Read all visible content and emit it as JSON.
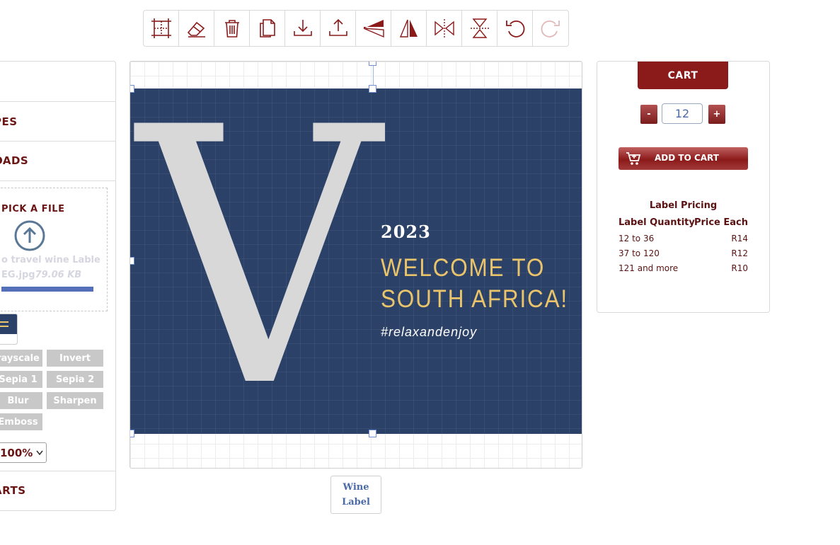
{
  "toolbar": {
    "tools": [
      {
        "icon": "crop-icon",
        "enabled": true
      },
      {
        "icon": "eraser-icon",
        "enabled": true
      },
      {
        "icon": "trash-icon",
        "enabled": true
      },
      {
        "icon": "copy-icon",
        "enabled": true
      },
      {
        "icon": "download-icon",
        "enabled": true
      },
      {
        "icon": "upload-icon",
        "enabled": true
      },
      {
        "icon": "send-back-icon",
        "enabled": true
      },
      {
        "icon": "bring-front-icon",
        "enabled": true
      },
      {
        "icon": "flip-horizontal-icon",
        "enabled": true
      },
      {
        "icon": "flip-vertical-icon",
        "enabled": true
      },
      {
        "icon": "undo-icon",
        "enabled": true
      },
      {
        "icon": "redo-icon",
        "enabled": false
      }
    ]
  },
  "left_panel": {
    "section_shapes": "PES",
    "section_uploads": "OADS",
    "upload": {
      "pick_label": "PICK A FILE",
      "file_name": "o travel wine Lable",
      "file_ext": "EG.jpg",
      "file_size": "79.06 KB",
      "progress": 1.0
    },
    "filters": [
      "rayscale",
      "Invert",
      "Sepia 1",
      "Sepia 2",
      "Blur",
      "Sharpen",
      "Emboss"
    ],
    "zoom_value": "100%",
    "section_carts": "ARTS"
  },
  "canvas": {
    "letter": "V",
    "year": "2023",
    "headline_1": "WELCOME TO",
    "headline_2": "SOUTH AFRICA!",
    "hashtag": "#relaxandenjoy"
  },
  "tabs": {
    "wine_label_1": "Wine",
    "wine_label_2": "Label"
  },
  "cart": {
    "title": "CART",
    "minus": "-",
    "plus": "+",
    "quantity": "12",
    "add_to_cart": "ADD TO CART",
    "pricing_title": "Label Pricing",
    "col_qty": "Label Quantity",
    "col_price": "Price Each",
    "rows": [
      {
        "qty": "12 to 36",
        "price": "R14"
      },
      {
        "qty": "37 to 120",
        "price": "R12"
      },
      {
        "qty": "121 and more",
        "price": "R10"
      }
    ]
  },
  "colors": {
    "brand": "#8b1a1a",
    "label_bg": "#2c4168",
    "headline": "#e9c46a",
    "accent_blue": "#4a6aa8"
  }
}
